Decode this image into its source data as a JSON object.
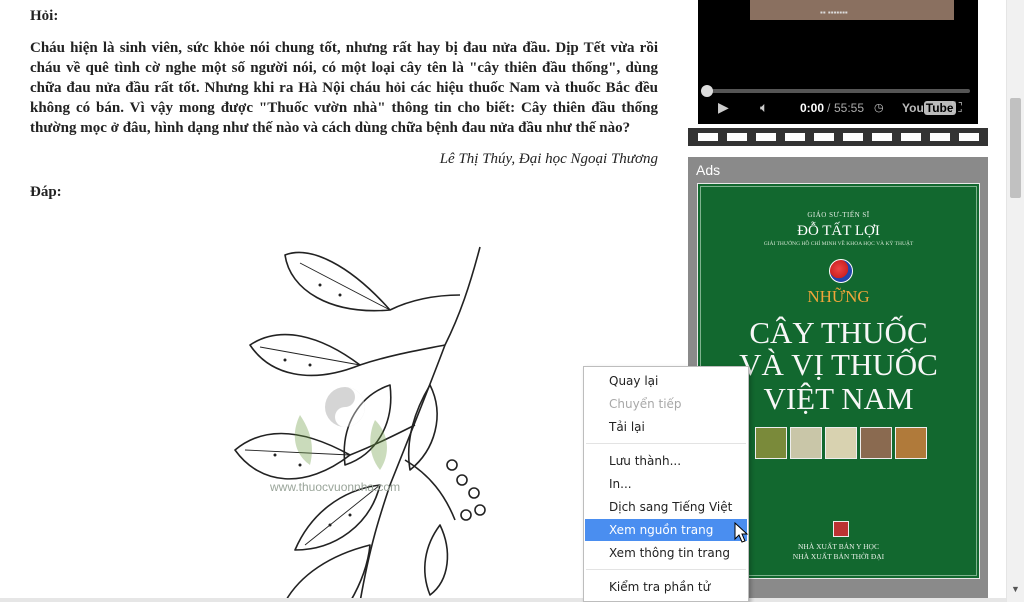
{
  "article": {
    "question_heading": "Hỏi:",
    "question_body": "Cháu hiện là sinh viên, sức khỏe nói chung tốt, nhưng rất hay bị đau nửa đầu. Dịp Tết vừa rồi cháu về quê tình cờ nghe một số người nói, có một loại cây tên là \"cây thiên đầu thống\", dùng chữa đau nửa đầu rất tốt. Nhưng khi ra Hà Nội cháu hỏi các hiệu thuốc Nam và thuốc Bắc đều không có bán. Vì vậy mong được \"Thuốc vườn nhà\" thông tin cho biết: Cây thiên đầu thống thường mọc ở đâu, hình dạng như thế nào và cách dùng chữa bệnh đau nửa đầu như thế nào?",
    "signature": "Lê Thị Thúy, Đại học Ngoại Thương",
    "answer_heading": "Đáp:",
    "image_watermark": "www.thuocvuonnha.com"
  },
  "video": {
    "current_time": "0:00",
    "separator": "/",
    "duration": "55:55",
    "logo_text_you": "You",
    "logo_text_tube": "Tube"
  },
  "ads": {
    "label": "Ads",
    "book": {
      "author_title": "GIÁO SƯ-TIẾN SĨ",
      "author": "ĐỖ TẤT LỢI",
      "award": "GIẢI THƯỞNG HỒ CHÍ MINH VỀ KHOA HỌC VÀ KỸ THUẬT",
      "title_prefix": "NHỮNG",
      "title_line1": "CÂY THUỐC",
      "title_line2": "VÀ VỊ THUỐC",
      "title_line3": "VIỆT NAM",
      "publisher1": "NHÀ XUẤT BẢN Y HỌC",
      "publisher2": "NHÀ XUẤT BẢN THỜI ĐẠI"
    }
  },
  "context_menu": {
    "items": [
      {
        "label": "Quay lại",
        "enabled": true
      },
      {
        "label": "Chuyển tiếp",
        "enabled": false
      },
      {
        "label": "Tải lại",
        "enabled": true
      },
      {
        "label": "Lưu thành...",
        "enabled": true
      },
      {
        "label": "In...",
        "enabled": true
      },
      {
        "label": "Dịch sang Tiếng Việt",
        "enabled": true
      },
      {
        "label": "Xem nguồn trang",
        "enabled": true,
        "highlighted": true
      },
      {
        "label": "Xem thông tin trang",
        "enabled": true
      },
      {
        "label": "Kiểm tra phần tử",
        "enabled": true
      }
    ]
  },
  "colors": {
    "menu_highlight": "#4a8ef0",
    "book_green": "#12682f",
    "book_title_orange": "#f0a53a"
  }
}
